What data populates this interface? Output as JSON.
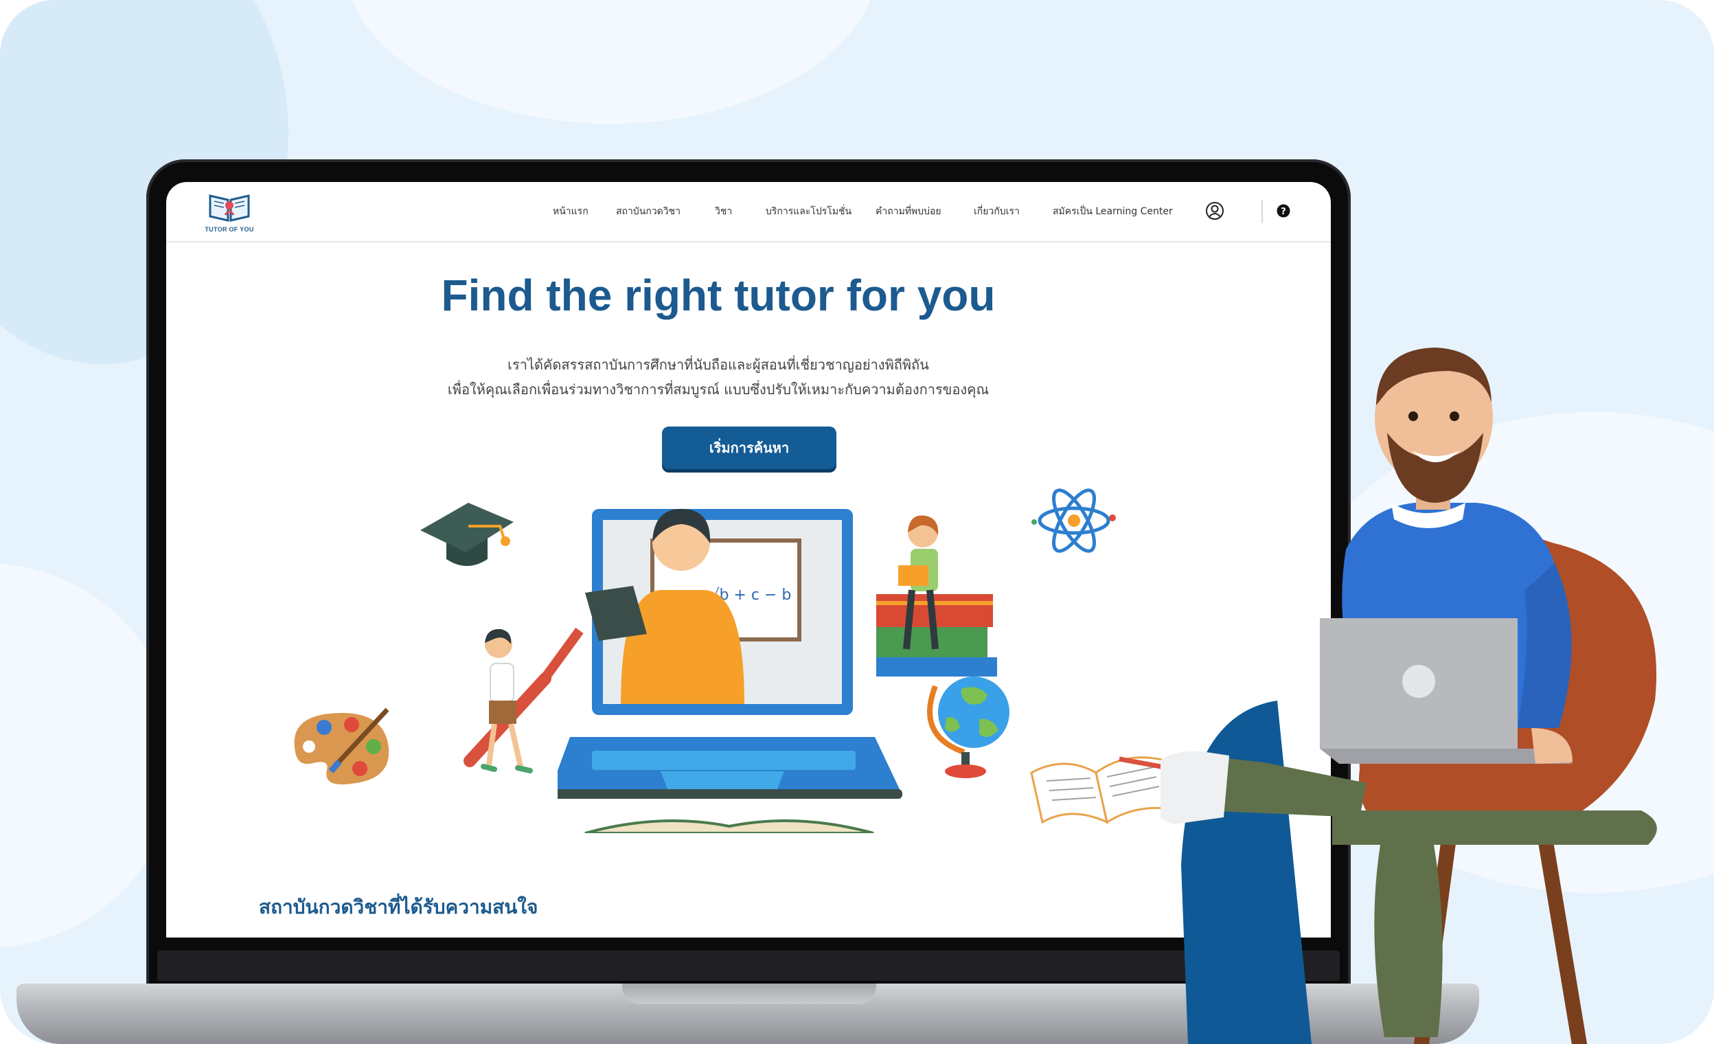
{
  "brand": {
    "logo_text": "TUTOR OF YOU"
  },
  "nav": {
    "items": [
      "หน้าแรก",
      "สถาบันกวดวิชา",
      "วิชา",
      "บริการและโปรโมชั่น",
      "คำถามที่พบบ่อย",
      "เกี่ยวกับเรา",
      "สมัครเป็น Learning Center"
    ],
    "icons": [
      "user-circle-icon",
      "help-icon"
    ]
  },
  "hero": {
    "title": "Find the right tutor for you",
    "subtitle_line1": "เราได้คัดสรรสถาบันการศึกษาที่นับถือและผู้สอนที่เชี่ยวชาญอย่างพิถีพิถัน",
    "subtitle_line2": "เพื่อให้คุณเลือกเพื่อนร่วมทางวิชาการที่สมบูรณ์ แบบซึ่งปรับให้เหมาะกับความต้องการของคุณ",
    "cta_label": "เริ่มการค้นหา"
  },
  "section": {
    "popular_title": "สถาบันกวดวิชาที่ได้รับความสนใจ"
  },
  "colors": {
    "primary": "#1c5a8f",
    "button": "#145c96",
    "background": "#e6f3fc",
    "accent_orange": "#f6a02a"
  }
}
